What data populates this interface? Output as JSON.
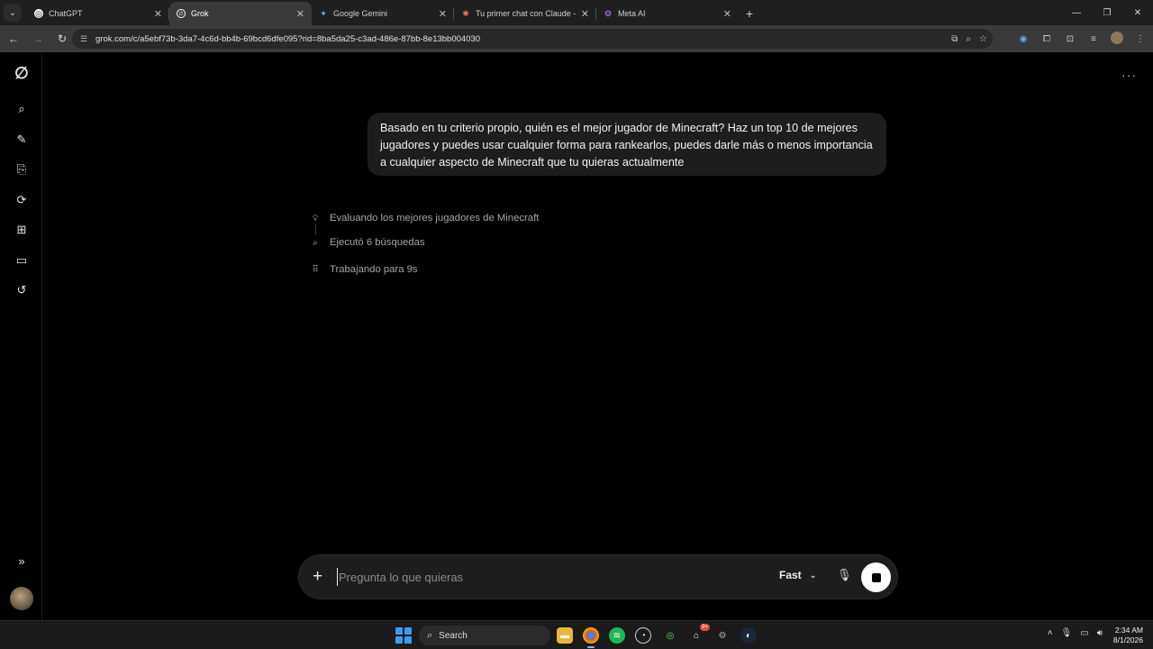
{
  "browser": {
    "tabs": [
      {
        "title": "ChatGPT",
        "icon": "chatgpt-icon",
        "active": false
      },
      {
        "title": "Grok",
        "icon": "grok-icon",
        "active": true
      },
      {
        "title": "Google Gemini",
        "icon": "gemini-icon",
        "active": false
      },
      {
        "title": "Tu primer chat con Claude - Cla",
        "icon": "claude-icon",
        "active": false
      },
      {
        "title": "Meta AI",
        "icon": "meta-ai-icon",
        "active": false
      }
    ],
    "url": "grok.com/c/a5ebf73b-3da7-4c6d-bb4b-69bcd6dfe095?rid=8ba5da25-c3ad-486e-87bb-8e13bb004030"
  },
  "chat": {
    "user_message": "Basado en tu criterio propio, quién es el mejor jugador de Minecraft? Haz un top 10 de mejores jugadores y puedes usar cualquier forma para rankearlos, puedes darle más o menos importancia a cualquier aspecto de Minecraft que tu quieras actualmente",
    "steps": [
      {
        "icon": "lightbulb-icon",
        "text": "Evaluando los mejores jugadores de Minecraft"
      },
      {
        "icon": "search-icon",
        "text": "Ejecutó 6 búsquedas"
      },
      {
        "icon": "dots-grid-icon",
        "text": "Trabajando para 9s"
      }
    ]
  },
  "composer": {
    "placeholder": "Pregunta lo que quieras",
    "model": "Fast"
  },
  "taskbar": {
    "search_label": "Search",
    "badge": "9+",
    "time": "2:34 AM",
    "date": "8/1/2026"
  }
}
